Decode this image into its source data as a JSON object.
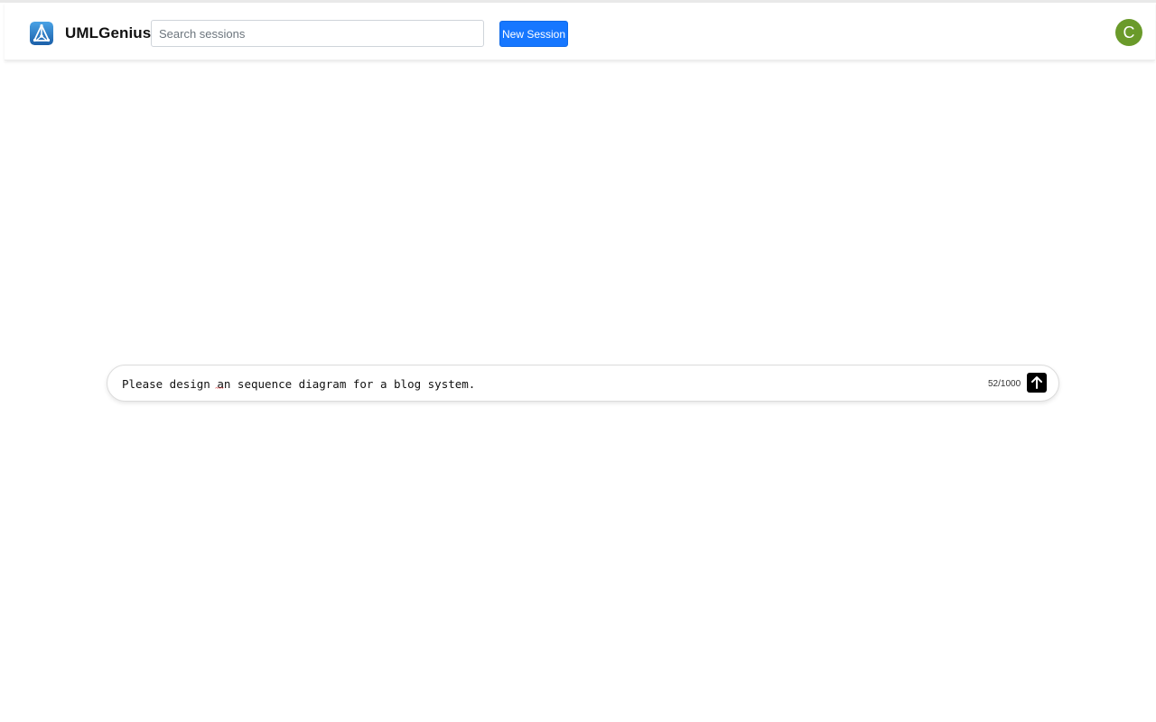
{
  "header": {
    "brand": "UMLGenius",
    "logo_icon": "triangle-network-logo-icon",
    "search": {
      "placeholder": "Search sessions",
      "value": ""
    },
    "new_session_label": "New Session",
    "avatar_initial": "C",
    "avatar_color": "#6a9a2a",
    "accent_color": "#1677ff"
  },
  "prompt": {
    "value": "Please design an sequence diagram for a blog system.",
    "counter": "52/1000",
    "send_icon": "arrow-up-icon"
  }
}
